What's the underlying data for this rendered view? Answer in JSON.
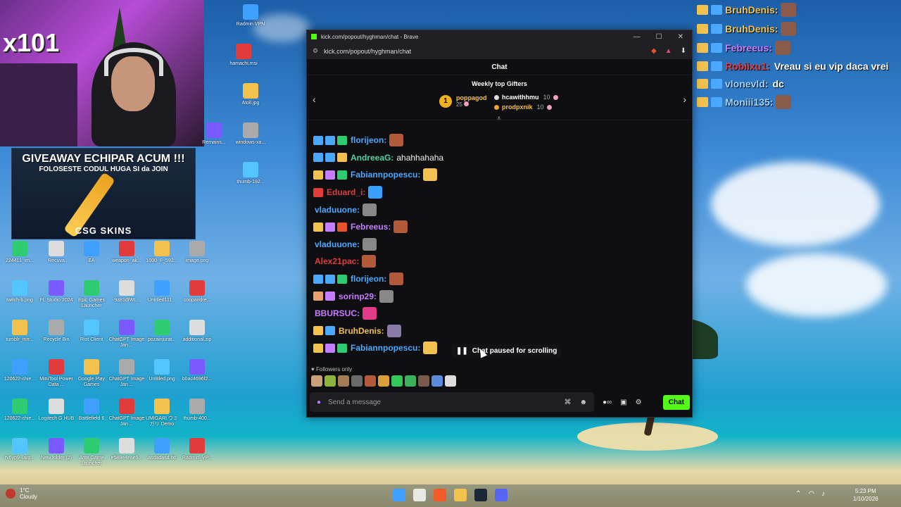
{
  "overlay": {
    "combo": "x101",
    "giveaway_title": "GIVEAWAY ECHIPAR ACUM !!!",
    "giveaway_sub": "FOLOSESTE CODUL HUGA SI da JOIN",
    "giveaway_brand": "CSG SKINS"
  },
  "desktop_icons": [
    {
      "label": "Radmin VPN"
    },
    {
      "label": "hamachi.msi"
    },
    {
      "label": "Atoll.jpg"
    },
    {
      "label": "windows-xa..."
    },
    {
      "label": "thumb-192..."
    },
    {
      "label": "Remains..."
    },
    {
      "label": "224411_im..."
    },
    {
      "label": "Recuva"
    },
    {
      "label": "EA"
    },
    {
      "label": "weapon_ak..."
    },
    {
      "label": "1000_F_592..."
    },
    {
      "label": "image.png"
    },
    {
      "label": "twitch-b.png"
    },
    {
      "label": "FL Studio 2024"
    },
    {
      "label": "Epic Games Launcher"
    },
    {
      "label": "-9a81dIWL..."
    },
    {
      "label": "Untitled111..."
    },
    {
      "label": "coopandre..."
    },
    {
      "label": "tumblr_mrr..."
    },
    {
      "label": "Recycle Bin"
    },
    {
      "label": "Riot Client"
    },
    {
      "label": "ChatGPT Image Jan ..."
    },
    {
      "label": "pozainjurat..."
    },
    {
      "label": "additional.zip"
    },
    {
      "label": "120622-chie..."
    },
    {
      "label": "MiniTool Power Data ..."
    },
    {
      "label": "Google Play Games"
    },
    {
      "label": "ChatGPT Image Jan ..."
    },
    {
      "label": "Untitled.png"
    },
    {
      "label": "b0ac4696f2..."
    },
    {
      "label": "120622-chie..."
    },
    {
      "label": "Logitech G HUB"
    },
    {
      "label": "Battlefield 6"
    },
    {
      "label": "ChatGPT Image Jan ..."
    },
    {
      "label": "UMIGARI ウミガリ Demo"
    },
    {
      "label": "thumb-400..."
    },
    {
      "label": "rv6yp9_larg..."
    },
    {
      "label": "New folder (2)"
    },
    {
      "label": "Artix Game Launcher"
    },
    {
      "label": "e588e4eae5..."
    },
    {
      "label": "asdadasd.txt"
    },
    {
      "label": "Radmin_VP..."
    }
  ],
  "overlay_chat": [
    {
      "user": "BruhDenis:",
      "text": "",
      "color": "#f2c14e"
    },
    {
      "user": "BruhDenis:",
      "text": "",
      "color": "#f2c14e"
    },
    {
      "user": "Febreeus:",
      "text": "",
      "color": "#c77dff"
    },
    {
      "user": "Robiixu1:",
      "text": "Vreau si eu vip daca vrei",
      "color": "#e23b3b"
    },
    {
      "user": "vlonevld:",
      "text": "dc",
      "color": "#9fd3ff"
    },
    {
      "user": "Moniii135:",
      "text": "",
      "color": "#9fd3ff"
    }
  ],
  "browser": {
    "title": "kick.com/popout/hyghman/chat - Brave",
    "url": "kick.com/popout/hyghman/chat"
  },
  "chat": {
    "header": "Chat",
    "gifters_title": "Weekly top Gifters",
    "top_gifter": {
      "rank": "1",
      "name": "poppagod",
      "count": "25"
    },
    "gifters": [
      {
        "name": "hcawithhmu",
        "count": "10",
        "color": "#ffffff"
      },
      {
        "name": "prodpxnik",
        "count": "10",
        "color": "#f2c14e"
      }
    ],
    "messages": [
      {
        "user": "florijeon:",
        "text": "",
        "color": "#4aa8ff"
      },
      {
        "user": "AndreeaG:",
        "text": "ahahhahaha",
        "color": "#4fd1a5"
      },
      {
        "user": "Fabiannpopescu:",
        "text": "",
        "color": "#4aa8ff"
      },
      {
        "user": "Eduard_i:",
        "text": "",
        "color": "#e23b3b"
      },
      {
        "user": "vladuuone:",
        "text": "",
        "color": "#4aa8ff"
      },
      {
        "user": "Febreeus:",
        "text": "",
        "color": "#c77dff"
      },
      {
        "user": "vladuuone:",
        "text": "",
        "color": "#4aa8ff"
      },
      {
        "user": "Alex21pac:",
        "text": "",
        "color": "#e23b3b"
      },
      {
        "user": "florijeon:",
        "text": "",
        "color": "#4aa8ff"
      },
      {
        "user": "sorinp29:",
        "text": "",
        "color": "#c77dff"
      },
      {
        "user": "BBURSUC:",
        "text": "",
        "color": "#c77dff"
      },
      {
        "user": "BruhDenis:",
        "text": "",
        "color": "#f2c14e"
      },
      {
        "user": "Fabiannpopescu:",
        "text": "",
        "color": "#4aa8ff"
      }
    ],
    "paused_label": "Chat paused for scrolling",
    "followers_only": "Followers only",
    "input_placeholder": "Send a message",
    "send_label": "Chat"
  },
  "taskbar": {
    "temperature": "1°C",
    "weather": "Cloudy",
    "time": "5:23 PM",
    "date": "1/10/2026"
  },
  "colors": {
    "accent": "#53fc18"
  }
}
